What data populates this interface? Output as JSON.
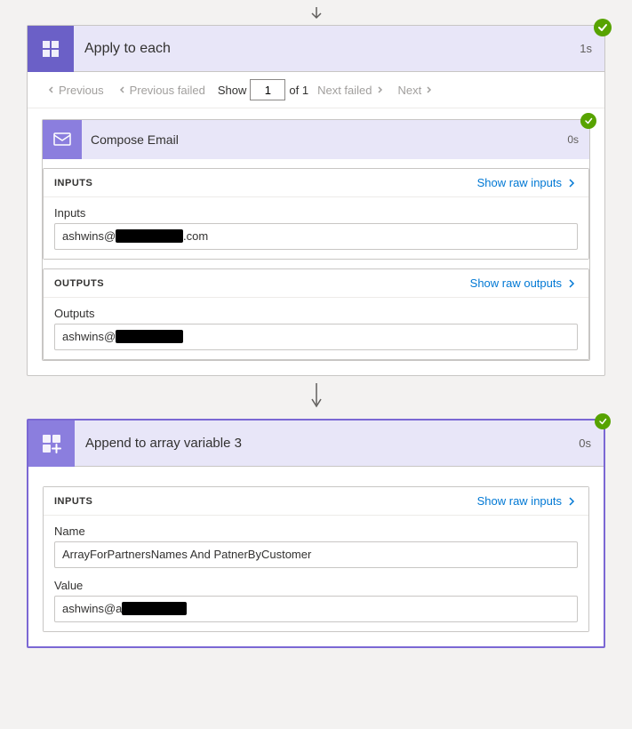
{
  "page": {
    "background_arrow": "↓"
  },
  "apply_each": {
    "title": "Apply to each",
    "duration": "1s",
    "icon_label": "apply-each-icon"
  },
  "pagination": {
    "previous_label": "Previous",
    "previous_failed_label": "Previous failed",
    "show_label": "Show",
    "current_page": "1",
    "total_pages": "of 1",
    "next_failed_label": "Next failed",
    "next_label": "Next"
  },
  "compose_email": {
    "title": "Compose Email",
    "duration": "0s",
    "inputs_title": "INPUTS",
    "show_raw_inputs": "Show raw inputs",
    "inputs_field_label": "Inputs",
    "inputs_field_value_prefix": "ashwins@",
    "inputs_field_value_suffix": ".com",
    "outputs_title": "OUTPUTS",
    "show_raw_outputs": "Show raw outputs",
    "outputs_field_label": "Outputs",
    "outputs_field_value_prefix": "ashwins@",
    "outputs_field_value_suffix": ""
  },
  "append_array": {
    "title": "Append to array variable 3",
    "duration": "0s",
    "inputs_title": "INPUTS",
    "show_raw_inputs": "Show raw inputs",
    "name_label": "Name",
    "name_value": "ArrayForPartnersNames And PatnerByCustomer",
    "value_label": "Value",
    "value_prefix": "ashwins@a",
    "value_suffix": ""
  }
}
